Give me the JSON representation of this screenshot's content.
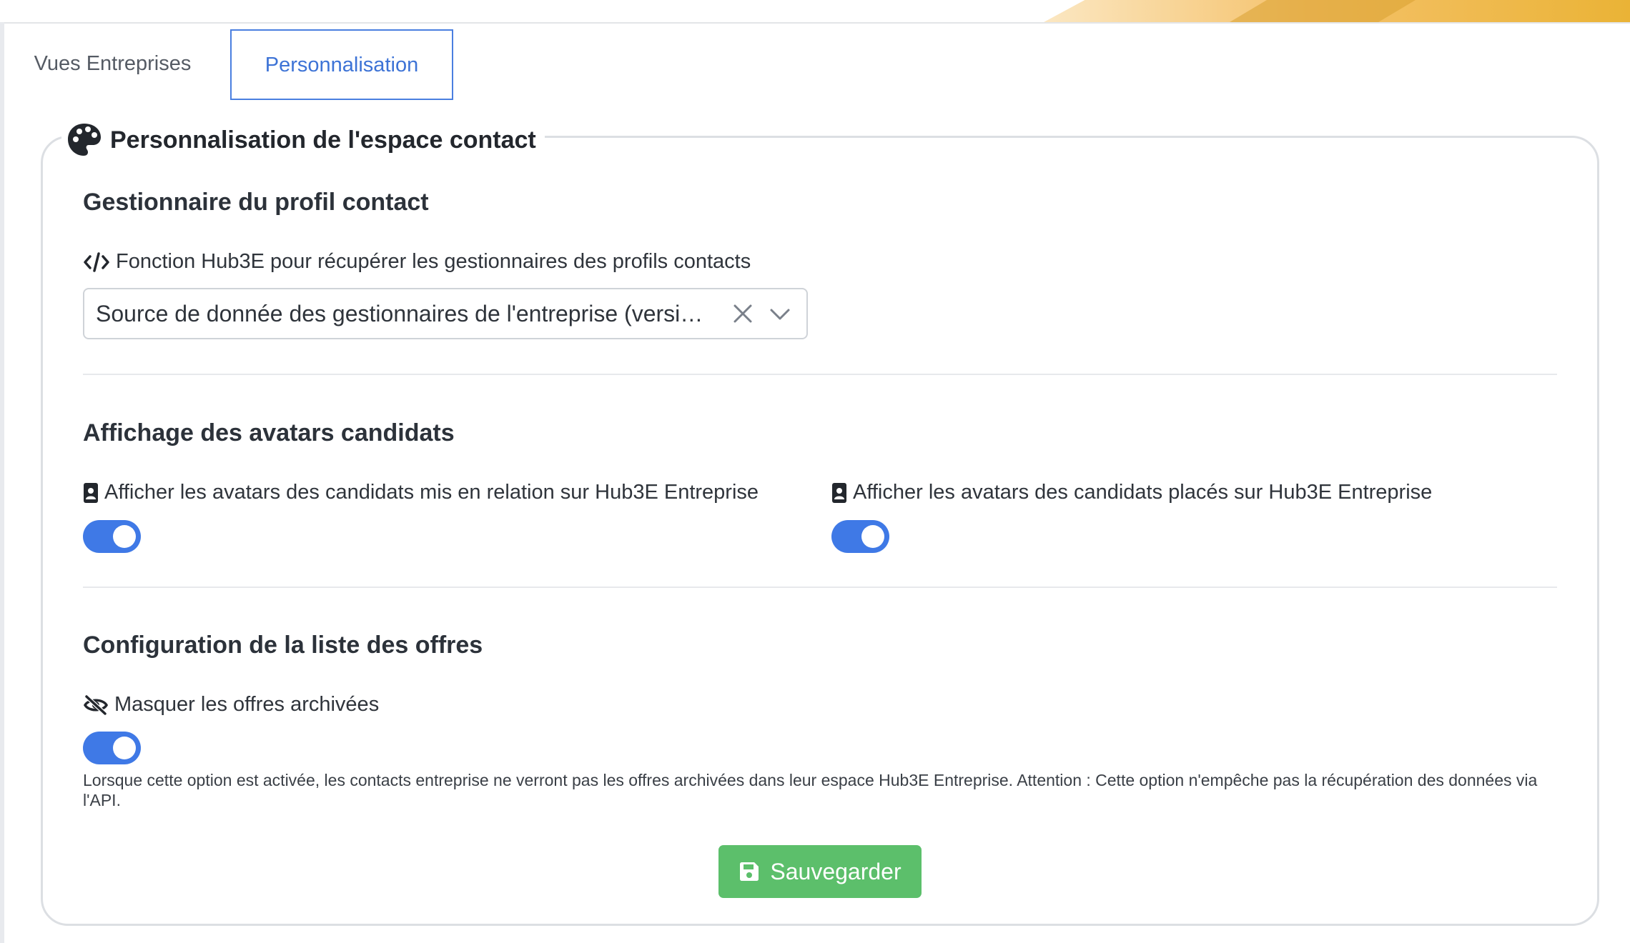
{
  "tabs": [
    {
      "label": "Vues Entreprises",
      "active": false
    },
    {
      "label": "Personnalisation",
      "active": true
    }
  ],
  "panel": {
    "title": "Personnalisation de l'espace contact",
    "title_icon": "palette-icon"
  },
  "manager_section": {
    "title": "Gestionnaire du profil contact",
    "field_label": "Fonction Hub3E pour récupérer les gestionnaires des profils contacts",
    "field_icon": "code-icon",
    "select_value": "Source de donnée des gestionnaires de l'entreprise (versi…"
  },
  "avatars_section": {
    "title": "Affichage des avatars candidats",
    "option_related": {
      "label": "Afficher les avatars des candidats mis en relation sur Hub3E Entreprise",
      "icon": "contact-card-icon",
      "enabled": true
    },
    "option_placed": {
      "label": "Afficher les avatars des candidats placés sur Hub3E Entreprise",
      "icon": "contact-card-icon",
      "enabled": true
    }
  },
  "offers_section": {
    "title": "Configuration de la liste des offres",
    "hide_archived": {
      "label": "Masquer les offres archivées",
      "icon": "eye-slash-icon",
      "enabled": true
    },
    "help_text": "Lorsque cette option est activée, les contacts entreprise ne verront pas les offres archivées dans leur espace Hub3E Entreprise. Attention : Cette option n'empêche pas la récupération des données via l'API."
  },
  "save_button": {
    "label": "Sauvegarder",
    "icon": "floppy-disk-icon"
  },
  "colors": {
    "accent": "#3d73d6",
    "toggle_on": "#3f79e6",
    "save": "#5cbf6b",
    "border": "#dcdfe3"
  }
}
